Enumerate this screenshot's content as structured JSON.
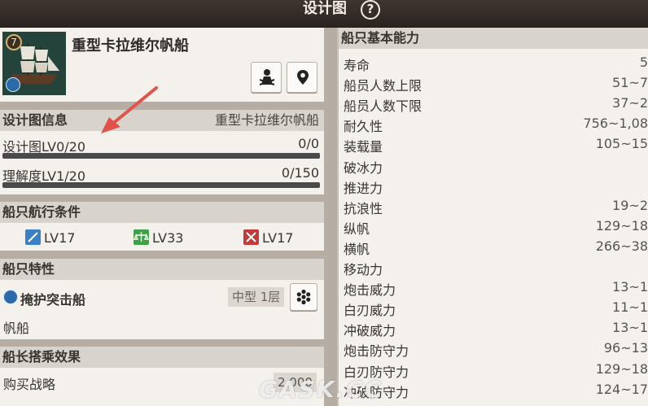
{
  "header": {
    "title": "设计图"
  },
  "ship": {
    "rank": "7",
    "name": "重型卡拉维尔帆船"
  },
  "blueprint": {
    "section_title": "设计图信息",
    "blueprint_name": "重型卡拉维尔帆船",
    "level_label": "设计图LV0/20",
    "level_value": "0/0",
    "level_progress": 0,
    "understanding_label": "理解度LV1/20",
    "understanding_value": "0/150",
    "understanding_progress": 0
  },
  "sailing": {
    "section_title": "船只航行条件",
    "conditions": [
      {
        "label": "LV17",
        "color": "#3b7fc4"
      },
      {
        "label": "LV33",
        "color": "#3fa048"
      },
      {
        "label": "LV17",
        "color": "#c23a3a"
      }
    ]
  },
  "traits": {
    "section_title": "船只特性",
    "trait_name": "掩护突击船",
    "tag": "中型 1层",
    "ship_type": "帆船"
  },
  "captain": {
    "section_title": "船长搭乘效果",
    "item_label": "购买战略",
    "item_value": "2,000"
  },
  "abilities": {
    "section_title": "船只基本能力",
    "rows": [
      {
        "label": "寿命",
        "value": "5"
      },
      {
        "label": "船员人数上限",
        "value": "51~7"
      },
      {
        "label": "船员人数下限",
        "value": "37~2"
      },
      {
        "label": "耐久性",
        "value": "756~1,08"
      },
      {
        "label": "装载量",
        "value": "105~15"
      },
      {
        "label": "破冰力",
        "value": ""
      },
      {
        "label": "推进力",
        "value": ""
      },
      {
        "label": "抗浪性",
        "value": "19~2"
      },
      {
        "label": "纵帆",
        "value": "129~18"
      },
      {
        "label": "横帆",
        "value": "266~38"
      },
      {
        "label": "移动力",
        "value": ""
      },
      {
        "label": "炮击威力",
        "value": "13~1"
      },
      {
        "label": "白刃威力",
        "value": "11~1"
      },
      {
        "label": "冲破威力",
        "value": "13~1"
      },
      {
        "label": "炮击防守力",
        "value": "96~13"
      },
      {
        "label": "白刃防守力",
        "value": "129~18"
      },
      {
        "label": "冲破防守力",
        "value": "124~17"
      }
    ]
  },
  "watermark": "GASK.CC"
}
